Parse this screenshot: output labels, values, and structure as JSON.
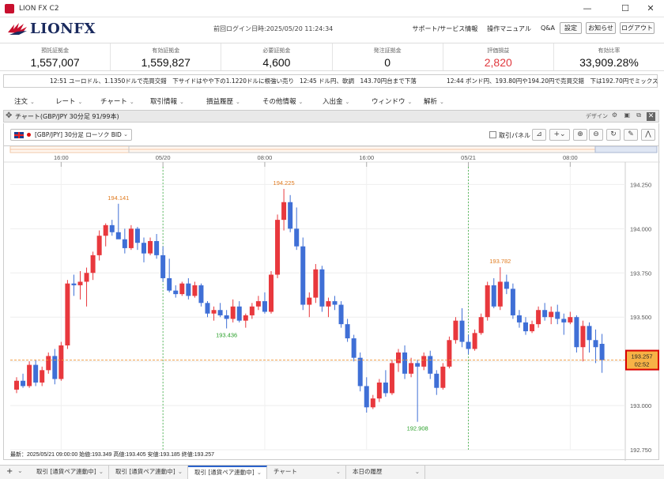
{
  "window": {
    "title": "LION FX C2",
    "minimize": "—",
    "maximize": "☐",
    "close": "✕"
  },
  "header": {
    "logo_text": "LIONFX",
    "last_login": "前回ログイン日時:2025/05/20 11:24:34",
    "links": [
      "サポート/サービス情報",
      "操作マニュアル",
      "Q&A"
    ],
    "buttons": {
      "settings": "設定",
      "notice": "お知らせ",
      "logout": "ログアウト"
    }
  },
  "summary": [
    {
      "label": "預託証拠金",
      "value": "1,557,007"
    },
    {
      "label": "有効証拠金",
      "value": "1,559,827"
    },
    {
      "label": "必要証拠金",
      "value": "4,600"
    },
    {
      "label": "発注証拠金",
      "value": "0"
    },
    {
      "label": "評価損益",
      "value": "2,820",
      "accent": "#e0393e"
    },
    {
      "label": "有効比率",
      "value": "33,909.28%"
    }
  ],
  "ticker": [
    "12:51  ユーロドル、1.1350ドルで売買交錯　下サイドはやや下の1.1220ドルに根強い売り",
    "12:45  ドル円、軟調　143.70円台まで下落",
    "12:44  ポンド円、193.80円や194.20円で売買交錯　下は192.70円でミックス"
  ],
  "menu": [
    "注文",
    "レート",
    "チャート",
    "取引情報",
    "損益履歴",
    "その他情報",
    "入出金",
    "ウィンドウ",
    "解析"
  ],
  "chart_panel": {
    "title": "チャート(GBP/JPY 30分足 91/99本)",
    "design_label": "デザイン",
    "pair_select": "[GBP/JPY] 30分足 ローソク BID",
    "trade_panel_label": "取引パネル"
  },
  "bottom_tabs": [
    "取引 [通貨ペア連動中]",
    "取引 [通貨ペア連動中]",
    "取引 [通貨ペア連動中]",
    "チャート",
    "本日の履歴"
  ],
  "chart_data": {
    "type": "candlestick",
    "pair": "GBP/JPY",
    "timeframe": "30分足",
    "ylim": [
      192.75,
      194.35
    ],
    "yticks": [
      192.75,
      193.0,
      193.25,
      193.5,
      193.75,
      194.0,
      194.25
    ],
    "ytick_labels": [
      "192.750",
      "193.000",
      "193.250",
      "193.500",
      "193.750",
      "194.000",
      "194.250"
    ],
    "xtick_labels": [
      "16:00",
      "05/20",
      "08:00",
      "16:00",
      "05/21",
      "08:00"
    ],
    "xtick_index": [
      7,
      23,
      39,
      55,
      71,
      87
    ],
    "date_lines_index": [
      23,
      71
    ],
    "current_price": {
      "value": 193.257,
      "label": "193.257",
      "countdown": "02:52"
    },
    "annotations": [
      {
        "label": "194.141",
        "index": 16,
        "value": 194.141,
        "pos": "above",
        "color": "#e07b20"
      },
      {
        "label": "193.436",
        "index": 33,
        "value": 193.436,
        "pos": "below",
        "color": "#2aa02a"
      },
      {
        "label": "194.225",
        "index": 42,
        "value": 194.225,
        "pos": "above",
        "color": "#e07b20"
      },
      {
        "label": "192.908",
        "index": 63,
        "value": 192.908,
        "pos": "below",
        "color": "#2aa02a"
      },
      {
        "label": "193.782",
        "index": 76,
        "value": 193.782,
        "pos": "above",
        "color": "#e07b20"
      }
    ],
    "colors": {
      "up": "#e8383d",
      "down": "#3f6fd6",
      "date_line": "#3cb043",
      "price_line": "#f39a3d"
    },
    "ohlc_info": "最新：2025/05/21 09:00:00  始値:193.349  高値:193.405  安値:193.185  終値:193.257",
    "candles": [
      [
        193.09,
        193.16,
        193.07,
        193.14
      ],
      [
        193.14,
        193.18,
        193.1,
        193.11
      ],
      [
        193.11,
        193.25,
        193.1,
        193.23
      ],
      [
        193.23,
        193.26,
        193.11,
        193.13
      ],
      [
        193.13,
        193.22,
        193.11,
        193.2
      ],
      [
        193.2,
        193.3,
        193.18,
        193.28
      ],
      [
        193.28,
        193.32,
        193.12,
        193.15
      ],
      [
        193.15,
        193.36,
        193.14,
        193.34
      ],
      [
        193.34,
        193.71,
        193.32,
        193.69
      ],
      [
        193.69,
        193.74,
        193.62,
        193.68
      ],
      [
        193.68,
        193.76,
        193.6,
        193.7
      ],
      [
        193.7,
        193.78,
        193.56,
        193.75
      ],
      [
        193.75,
        193.87,
        193.71,
        193.85
      ],
      [
        193.85,
        193.99,
        193.82,
        193.96
      ],
      [
        193.96,
        194.03,
        193.9,
        194.02
      ],
      [
        194.02,
        194.05,
        193.96,
        193.98
      ],
      [
        193.98,
        194.141,
        193.97,
        193.94
      ],
      [
        193.94,
        194.0,
        193.86,
        193.89
      ],
      [
        193.89,
        194.02,
        193.88,
        194.0
      ],
      [
        194.0,
        194.01,
        193.88,
        193.92
      ],
      [
        193.92,
        193.95,
        193.81,
        193.86
      ],
      [
        193.86,
        193.95,
        193.85,
        193.93
      ],
      [
        193.93,
        193.97,
        193.83,
        193.85
      ],
      [
        193.85,
        193.9,
        193.7,
        193.72
      ],
      [
        193.72,
        193.83,
        193.64,
        193.65
      ],
      [
        193.65,
        193.68,
        193.61,
        193.63
      ],
      [
        193.63,
        193.7,
        193.62,
        193.69
      ],
      [
        193.69,
        193.72,
        193.6,
        193.62
      ],
      [
        193.62,
        193.7,
        193.61,
        193.68
      ],
      [
        193.68,
        193.69,
        193.56,
        193.58
      ],
      [
        193.58,
        193.59,
        193.5,
        193.52
      ],
      [
        193.52,
        193.56,
        193.48,
        193.54
      ],
      [
        193.54,
        193.58,
        193.5,
        193.51
      ],
      [
        193.51,
        193.54,
        193.436,
        193.49
      ],
      [
        193.49,
        193.6,
        193.47,
        193.56
      ],
      [
        193.56,
        193.59,
        193.47,
        193.48
      ],
      [
        193.48,
        193.52,
        193.44,
        193.51
      ],
      [
        193.51,
        193.58,
        193.49,
        193.56
      ],
      [
        193.56,
        193.62,
        193.54,
        193.59
      ],
      [
        193.59,
        193.64,
        193.52,
        193.53
      ],
      [
        193.53,
        193.76,
        193.52,
        193.74
      ],
      [
        193.74,
        194.08,
        193.72,
        194.05
      ],
      [
        194.05,
        194.225,
        193.99,
        194.15
      ],
      [
        194.15,
        194.19,
        193.98,
        194.0
      ],
      [
        194.0,
        194.12,
        193.88,
        193.9
      ],
      [
        193.9,
        193.95,
        193.54,
        193.57
      ],
      [
        193.57,
        193.64,
        193.5,
        193.61
      ],
      [
        193.61,
        193.8,
        193.58,
        193.77
      ],
      [
        193.77,
        193.79,
        193.53,
        193.56
      ],
      [
        193.56,
        193.61,
        193.5,
        193.59
      ],
      [
        193.59,
        193.62,
        193.54,
        193.57
      ],
      [
        193.57,
        193.59,
        193.44,
        193.46
      ],
      [
        193.46,
        193.49,
        193.36,
        193.38
      ],
      [
        193.38,
        193.4,
        193.25,
        193.27
      ],
      [
        193.27,
        193.3,
        193.08,
        193.11
      ],
      [
        193.11,
        193.16,
        192.96,
        192.99
      ],
      [
        192.99,
        193.06,
        192.98,
        193.04
      ],
      [
        193.04,
        193.15,
        193.02,
        193.13
      ],
      [
        193.13,
        193.2,
        193.05,
        193.07
      ],
      [
        193.07,
        193.26,
        193.06,
        193.24
      ],
      [
        193.24,
        193.32,
        193.19,
        193.3
      ],
      [
        193.3,
        193.34,
        193.15,
        193.18
      ],
      [
        193.18,
        193.27,
        193.16,
        193.24
      ],
      [
        193.24,
        193.26,
        192.908,
        193.22
      ],
      [
        193.22,
        193.3,
        193.2,
        193.28
      ],
      [
        193.28,
        193.31,
        193.15,
        193.18
      ],
      [
        193.18,
        193.2,
        193.06,
        193.1
      ],
      [
        193.1,
        193.24,
        193.09,
        193.22
      ],
      [
        193.22,
        193.39,
        193.21,
        193.37
      ],
      [
        193.37,
        193.5,
        193.35,
        193.48
      ],
      [
        193.48,
        193.55,
        193.33,
        193.36
      ],
      [
        193.36,
        193.4,
        193.29,
        193.32
      ],
      [
        193.32,
        193.43,
        193.31,
        193.41
      ],
      [
        193.41,
        193.52,
        193.4,
        193.5
      ],
      [
        193.5,
        193.7,
        193.48,
        193.68
      ],
      [
        193.68,
        193.72,
        193.55,
        193.56
      ],
      [
        193.56,
        193.782,
        193.54,
        193.7
      ],
      [
        193.7,
        193.74,
        193.63,
        193.66
      ],
      [
        193.66,
        193.69,
        193.49,
        193.51
      ],
      [
        193.51,
        193.54,
        193.44,
        193.47
      ],
      [
        193.47,
        193.5,
        193.4,
        193.42
      ],
      [
        193.42,
        193.48,
        193.41,
        193.46
      ],
      [
        193.46,
        193.56,
        193.44,
        193.54
      ],
      [
        193.54,
        193.58,
        193.48,
        193.5
      ],
      [
        193.5,
        193.56,
        193.46,
        193.53
      ],
      [
        193.53,
        193.57,
        193.46,
        193.49
      ],
      [
        193.49,
        193.52,
        193.4,
        193.47
      ],
      [
        193.47,
        193.53,
        193.46,
        193.5
      ],
      [
        193.5,
        193.51,
        193.3,
        193.33
      ],
      [
        193.33,
        193.48,
        193.25,
        193.45
      ],
      [
        193.45,
        193.47,
        193.3,
        193.37
      ],
      [
        193.37,
        193.43,
        193.24,
        193.33
      ],
      [
        193.349,
        193.405,
        193.185,
        193.257
      ]
    ]
  }
}
